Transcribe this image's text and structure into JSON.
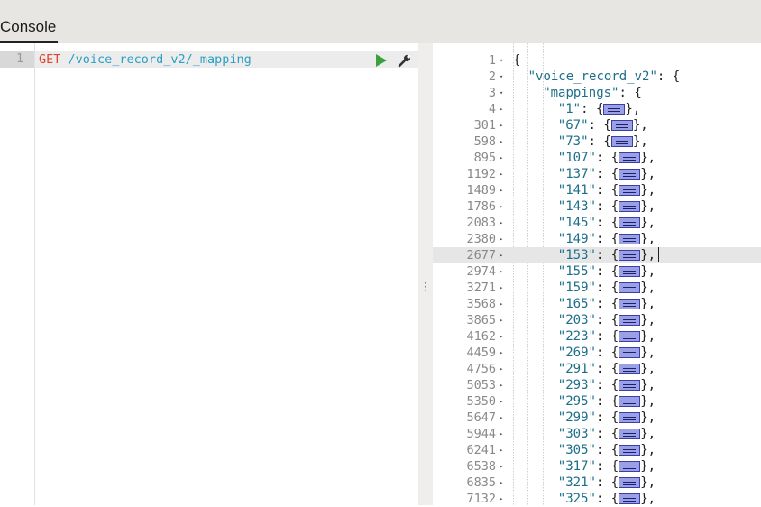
{
  "header": {
    "tab_label": "Console"
  },
  "request": {
    "line_number": "1",
    "method": "GET",
    "path": "/voice_record_v2/_mapping"
  },
  "response": {
    "lines": [
      {
        "num": "1",
        "fold": "▾",
        "indent": 0,
        "key": "",
        "text": "{",
        "collapsed": false
      },
      {
        "num": "2",
        "fold": "▾",
        "indent": 1,
        "key": "\"voice_record_v2\"",
        "text": ": {",
        "collapsed": false
      },
      {
        "num": "3",
        "fold": "▾",
        "indent": 2,
        "key": "\"mappings\"",
        "text": ": {",
        "collapsed": false
      },
      {
        "num": "4",
        "fold": "▸",
        "indent": 3,
        "key": "\"1\"",
        "text": ": {",
        "collapsed": true
      },
      {
        "num": "301",
        "fold": "▸",
        "indent": 3,
        "key": "\"67\"",
        "text": ": {",
        "collapsed": true
      },
      {
        "num": "598",
        "fold": "▸",
        "indent": 3,
        "key": "\"73\"",
        "text": ": {",
        "collapsed": true
      },
      {
        "num": "895",
        "fold": "▸",
        "indent": 3,
        "key": "\"107\"",
        "text": ": {",
        "collapsed": true
      },
      {
        "num": "1192",
        "fold": "▸",
        "indent": 3,
        "key": "\"137\"",
        "text": ": {",
        "collapsed": true
      },
      {
        "num": "1489",
        "fold": "▸",
        "indent": 3,
        "key": "\"141\"",
        "text": ": {",
        "collapsed": true
      },
      {
        "num": "1786",
        "fold": "▸",
        "indent": 3,
        "key": "\"143\"",
        "text": ": {",
        "collapsed": true
      },
      {
        "num": "2083",
        "fold": "▸",
        "indent": 3,
        "key": "\"145\"",
        "text": ": {",
        "collapsed": true
      },
      {
        "num": "2380",
        "fold": "▸",
        "indent": 3,
        "key": "\"149\"",
        "text": ": {",
        "collapsed": true
      },
      {
        "num": "2677",
        "fold": "▸",
        "indent": 3,
        "key": "\"153\"",
        "text": ": {",
        "collapsed": true,
        "highlight": true
      },
      {
        "num": "2974",
        "fold": "▸",
        "indent": 3,
        "key": "\"155\"",
        "text": ": {",
        "collapsed": true
      },
      {
        "num": "3271",
        "fold": "▸",
        "indent": 3,
        "key": "\"159\"",
        "text": ": {",
        "collapsed": true
      },
      {
        "num": "3568",
        "fold": "▸",
        "indent": 3,
        "key": "\"165\"",
        "text": ": {",
        "collapsed": true
      },
      {
        "num": "3865",
        "fold": "▸",
        "indent": 3,
        "key": "\"203\"",
        "text": ": {",
        "collapsed": true
      },
      {
        "num": "4162",
        "fold": "▸",
        "indent": 3,
        "key": "\"223\"",
        "text": ": {",
        "collapsed": true
      },
      {
        "num": "4459",
        "fold": "▸",
        "indent": 3,
        "key": "\"269\"",
        "text": ": {",
        "collapsed": true
      },
      {
        "num": "4756",
        "fold": "▸",
        "indent": 3,
        "key": "\"291\"",
        "text": ": {",
        "collapsed": true
      },
      {
        "num": "5053",
        "fold": "▸",
        "indent": 3,
        "key": "\"293\"",
        "text": ": {",
        "collapsed": true
      },
      {
        "num": "5350",
        "fold": "▸",
        "indent": 3,
        "key": "\"295\"",
        "text": ": {",
        "collapsed": true
      },
      {
        "num": "5647",
        "fold": "▸",
        "indent": 3,
        "key": "\"299\"",
        "text": ": {",
        "collapsed": true
      },
      {
        "num": "5944",
        "fold": "▸",
        "indent": 3,
        "key": "\"303\"",
        "text": ": {",
        "collapsed": true
      },
      {
        "num": "6241",
        "fold": "▸",
        "indent": 3,
        "key": "\"305\"",
        "text": ": {",
        "collapsed": true
      },
      {
        "num": "6538",
        "fold": "▸",
        "indent": 3,
        "key": "\"317\"",
        "text": ": {",
        "collapsed": true
      },
      {
        "num": "6835",
        "fold": "▸",
        "indent": 3,
        "key": "\"321\"",
        "text": ": {",
        "collapsed": true
      },
      {
        "num": "7132",
        "fold": "▸",
        "indent": 3,
        "key": "\"325\"",
        "text": ": {",
        "collapsed": true
      }
    ],
    "collapsed_suffix": "},"
  },
  "colors": {
    "method": "#e0442e",
    "path": "#2aa1c4",
    "run": "#3aa23a",
    "string": "#1d6f8a"
  },
  "icons": {
    "run": "play-icon",
    "settings": "wrench-icon",
    "splitter": "vertical-ellipsis-icon"
  }
}
